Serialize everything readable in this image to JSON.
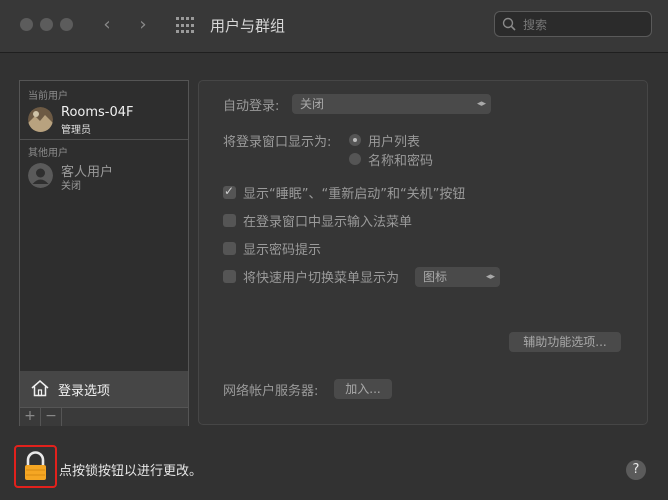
{
  "window": {
    "title": "用户与群组"
  },
  "search": {
    "placeholder": "搜索"
  },
  "sidebar": {
    "current_users_label": "当前用户",
    "current_user": {
      "name": "Rooms-04F",
      "role": "管理员"
    },
    "other_users_label": "其他用户",
    "other_user": {
      "name": "客人用户",
      "status": "关闭"
    },
    "login_options_label": "登录选项",
    "add_label": "+",
    "remove_label": "−"
  },
  "login": {
    "auto_login_label": "自动登录:",
    "auto_login_value": "关闭",
    "display_as_label": "将登录窗口显示为:",
    "radio_options": [
      {
        "label": "用户列表",
        "selected": true
      },
      {
        "label": "名称和密码",
        "selected": false
      }
    ],
    "checkboxes": [
      {
        "label": "显示“睡眠”、“重新启动”和“关机”按钮",
        "checked": true
      },
      {
        "label": "在登录窗口中显示输入法菜单",
        "checked": false
      },
      {
        "label": "显示密码提示",
        "checked": false
      },
      {
        "label": "将快速用户切换菜单显示为",
        "checked": false
      }
    ],
    "fast_switch_value": "图标",
    "accessibility_button": "辅助功能选项...",
    "network_server_label": "网络帐户服务器:",
    "join_button": "加入..."
  },
  "footer": {
    "lock_text": "点按锁按钮以进行更改。",
    "help_label": "?"
  },
  "colors": {
    "lock_highlight": "#e2211c",
    "lock_icon": "#f5a623"
  }
}
